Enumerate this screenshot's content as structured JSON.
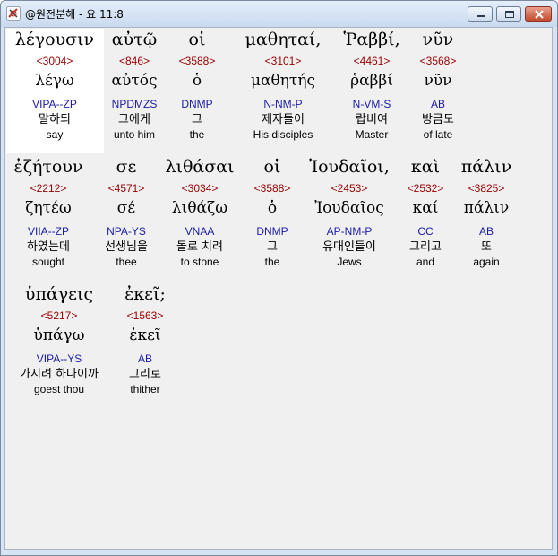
{
  "window": {
    "title": "@원전분해 - 요 11:8"
  },
  "rows": [
    [
      {
        "greek": "λέγουσιν",
        "strong": "<3004>",
        "lemma": "λέγω",
        "parse": "VIPA--ZP",
        "korean": "말하되",
        "english": "say"
      },
      {
        "greek": "αὐτῷ",
        "strong": "<846>",
        "lemma": "αὐτός",
        "parse": "NPDMZS",
        "korean": "그에게",
        "english": "unto him"
      },
      {
        "greek": "οἱ",
        "strong": "<3588>",
        "lemma": "ὁ",
        "parse": "DNMP",
        "korean": "그",
        "english": "the"
      },
      {
        "greek": "μαθηταί,",
        "strong": "<3101>",
        "lemma": "μαθητής",
        "parse": "N-NM-P",
        "korean": "제자들이",
        "english": "His disciples"
      },
      {
        "greek": "Ῥαββί,",
        "strong": "<4461>",
        "lemma": "ῥαββί",
        "parse": "N-VM-S",
        "korean": "랍비여",
        "english": "Master"
      },
      {
        "greek": "νῦν",
        "strong": "<3568>",
        "lemma": "νῦν",
        "parse": "AB",
        "korean": "방금도",
        "english": "of late"
      }
    ],
    [
      {
        "greek": "ἐζήτουν",
        "strong": "<2212>",
        "lemma": "ζητέω",
        "parse": "VIIA--ZP",
        "korean": "하였는데",
        "english": "sought"
      },
      {
        "greek": "σε",
        "strong": "<4571>",
        "lemma": "σέ",
        "parse": "NPA-YS",
        "korean": "선생님을",
        "english": "thee"
      },
      {
        "greek": "λιθάσαι",
        "strong": "<3034>",
        "lemma": "λιθάζω",
        "parse": "VNAA",
        "korean": "돌로 치려",
        "english": "to stone"
      },
      {
        "greek": "οἱ",
        "strong": "<3588>",
        "lemma": "ὁ",
        "parse": "DNMP",
        "korean": "그",
        "english": "the"
      },
      {
        "greek": "Ἰουδαῖοι,",
        "strong": "<2453>",
        "lemma": "Ἰουδαῖος",
        "parse": "AP-NM-P",
        "korean": "유대인들이",
        "english": "Jews"
      },
      {
        "greek": "καὶ",
        "strong": "<2532>",
        "lemma": "καί",
        "parse": "CC",
        "korean": "그리고",
        "english": "and"
      },
      {
        "greek": "πάλιν",
        "strong": "<3825>",
        "lemma": "πάλιν",
        "parse": "AB",
        "korean": "또",
        "english": "again"
      }
    ],
    [
      {
        "greek": "ὑπάγεις",
        "strong": "<5217>",
        "lemma": "ὑπάγω",
        "parse": "VIPA--YS",
        "korean": "가시려 하나이까",
        "english": "goest thou"
      },
      {
        "greek": "ἐκεῖ;",
        "strong": "<1563>",
        "lemma": "ἐκεῖ",
        "parse": "AB",
        "korean": "그리로",
        "english": "thither"
      }
    ]
  ]
}
